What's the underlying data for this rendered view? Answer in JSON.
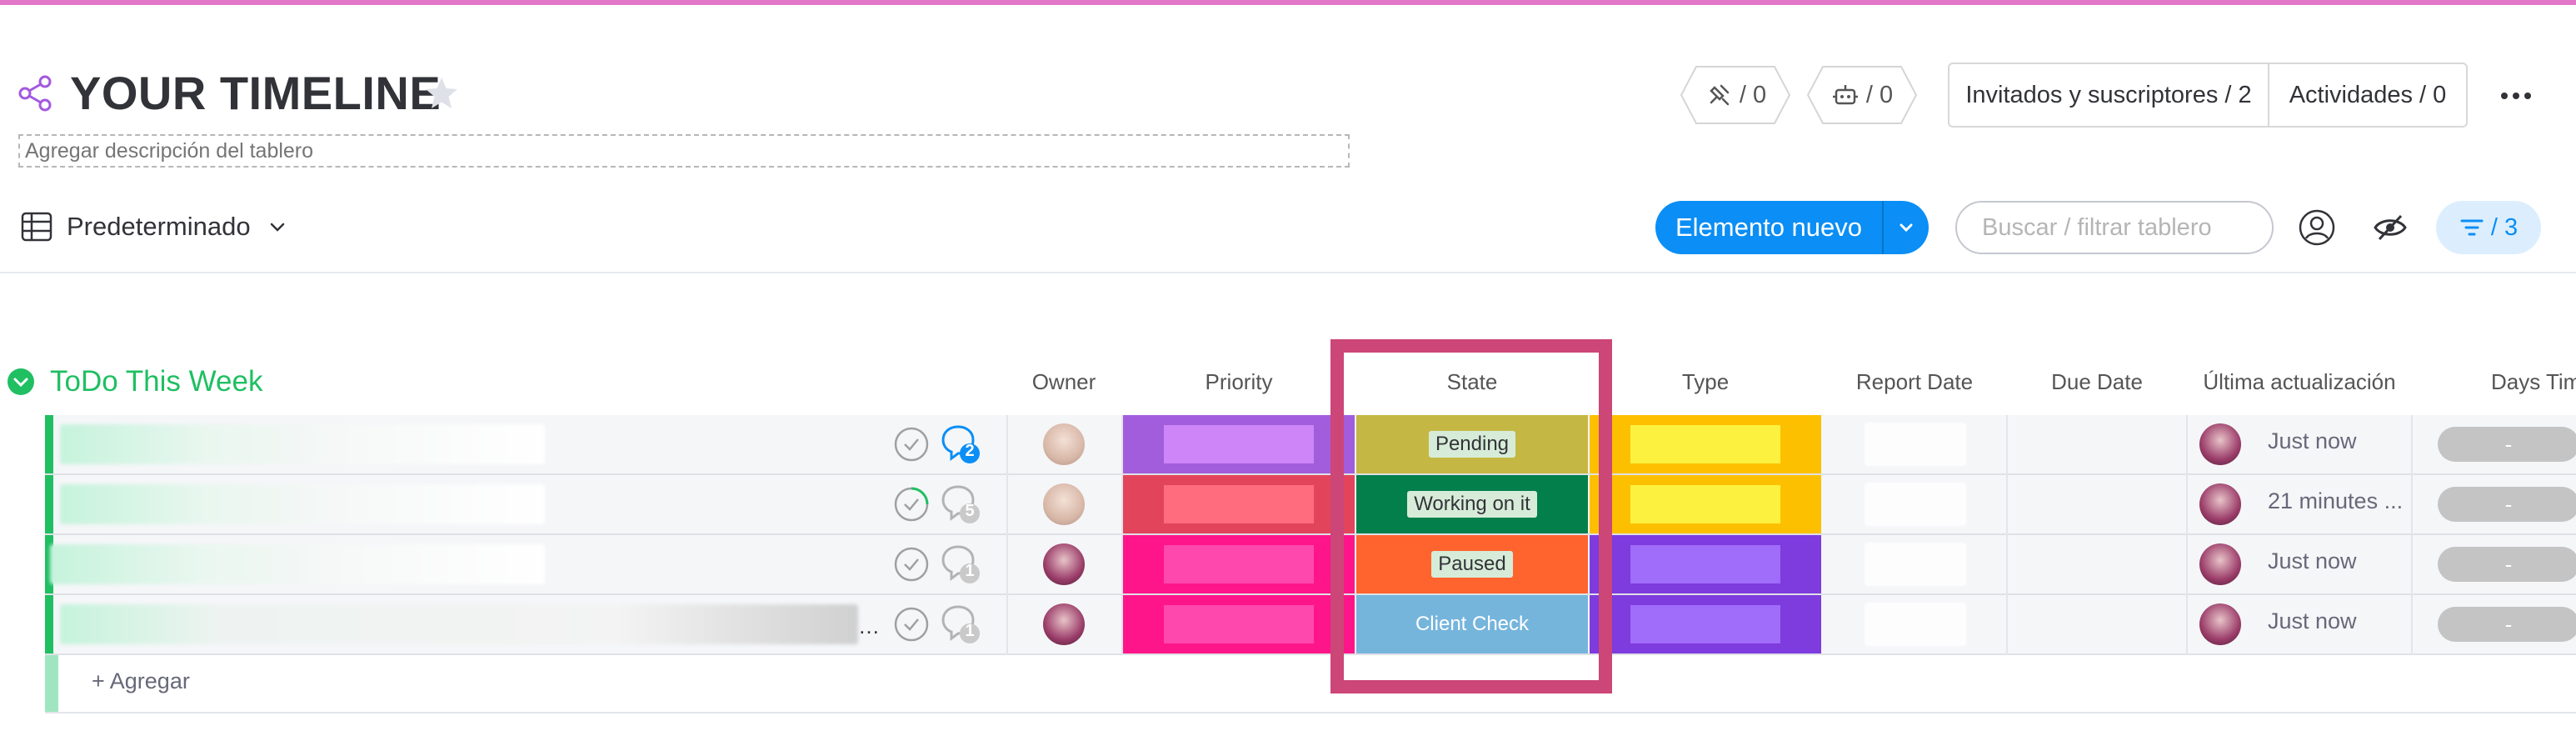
{
  "board": {
    "title": "YOUR TIMELINE",
    "description_placeholder": "Agregar descripción del tablero",
    "integrations_count": "/ 0",
    "automations_count": "/ 0",
    "guests_label": "Invitados y suscriptores / 2",
    "activity_label": "Actividades / 0"
  },
  "view": {
    "name": "Predeterminado",
    "new_item_label": "Elemento nuevo",
    "search_placeholder": "Buscar / filtrar tablero",
    "filter_count": "/ 3"
  },
  "group": {
    "title": "ToDo This Week",
    "color": "#1fbf62",
    "add_label": "+ Agregar"
  },
  "columns": [
    "Owner",
    "Priority",
    "State",
    "Type",
    "Report Date",
    "Due Date",
    "Última actualización",
    "Days Tim"
  ],
  "rows": [
    {
      "updates": "2",
      "state": "Pending",
      "updated": "Just now",
      "days": "-",
      "priority_color": "#a25ddc",
      "priority_inner": "#cd85f7",
      "state_color": "#c4b743",
      "state_text_bg": "#d7ecd8",
      "type_color": "#fdc000",
      "type_inner": "#fdf140"
    },
    {
      "updates": "5",
      "state": "Working on it",
      "updated": "21 minutes ...",
      "days": "-",
      "priority_color": "#e2445c",
      "priority_inner": "#ff6c7e",
      "state_color": "#037f4c",
      "state_text_bg": "#d7ecd8",
      "type_color": "#fdc000",
      "type_inner": "#fdf140"
    },
    {
      "updates": "1",
      "state": "Paused",
      "updated": "Just now",
      "days": "-",
      "priority_color": "#ff158a",
      "priority_inner": "#ff48ad",
      "state_color": "#ff642e",
      "state_text_bg": "#d7ecd8",
      "type_color": "#7e3bdd",
      "type_inner": "#a06cfa"
    },
    {
      "updates": "1",
      "state": "Client Check",
      "updated": "Just now",
      "days": "-",
      "priority_color": "#ff158a",
      "priority_inner": "#ff48ad",
      "state_color": "#75b5dc",
      "state_text_bg": "#75b5dc",
      "type_color": "#7e3bdd",
      "type_inner": "#a06cfa"
    }
  ],
  "colors": {
    "accent": "#0b8ef5",
    "highlight": "#cc4677",
    "topline": "#e277c8"
  },
  "icons": [
    "share-icon",
    "star-icon",
    "integrations-icon",
    "robot-icon",
    "more-icon",
    "table-icon",
    "chevron-down-icon",
    "person-icon",
    "eye-off-icon",
    "filter-icon",
    "check-icon",
    "update-bubble-icon",
    "avatar"
  ]
}
